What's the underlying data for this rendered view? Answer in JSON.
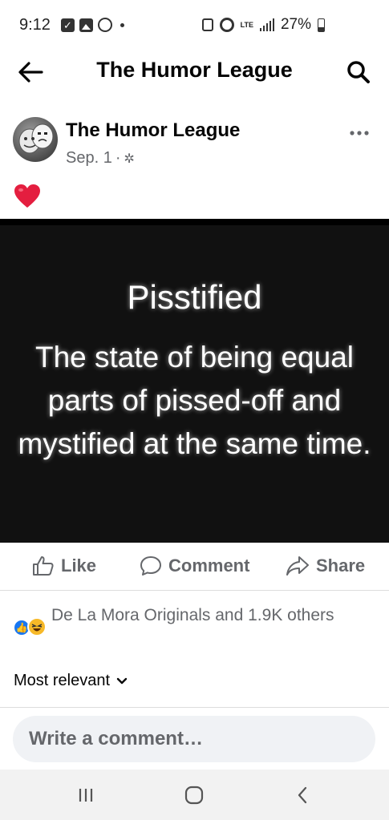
{
  "status_bar": {
    "time": "9:12",
    "network": "LTE",
    "battery": "27%"
  },
  "header": {
    "title": "The Humor League"
  },
  "post": {
    "author": "The Humor League",
    "date": "Sep. 1",
    "separator": "·",
    "image_text": {
      "title": "Pisstified",
      "body": "The state of being equal parts of pissed-off and mystified at the same time."
    }
  },
  "actions": {
    "like": "Like",
    "comment": "Comment",
    "share": "Share"
  },
  "reactions": {
    "summary": "De La Mora Originals and 1.9K others"
  },
  "comments": {
    "sort_label": "Most relevant",
    "input_placeholder": "Write a comment…"
  },
  "colors": {
    "accent": "#1877f2",
    "heart": "#e41e3f",
    "haha": "#f7b928",
    "secondary_text": "#65676b"
  }
}
